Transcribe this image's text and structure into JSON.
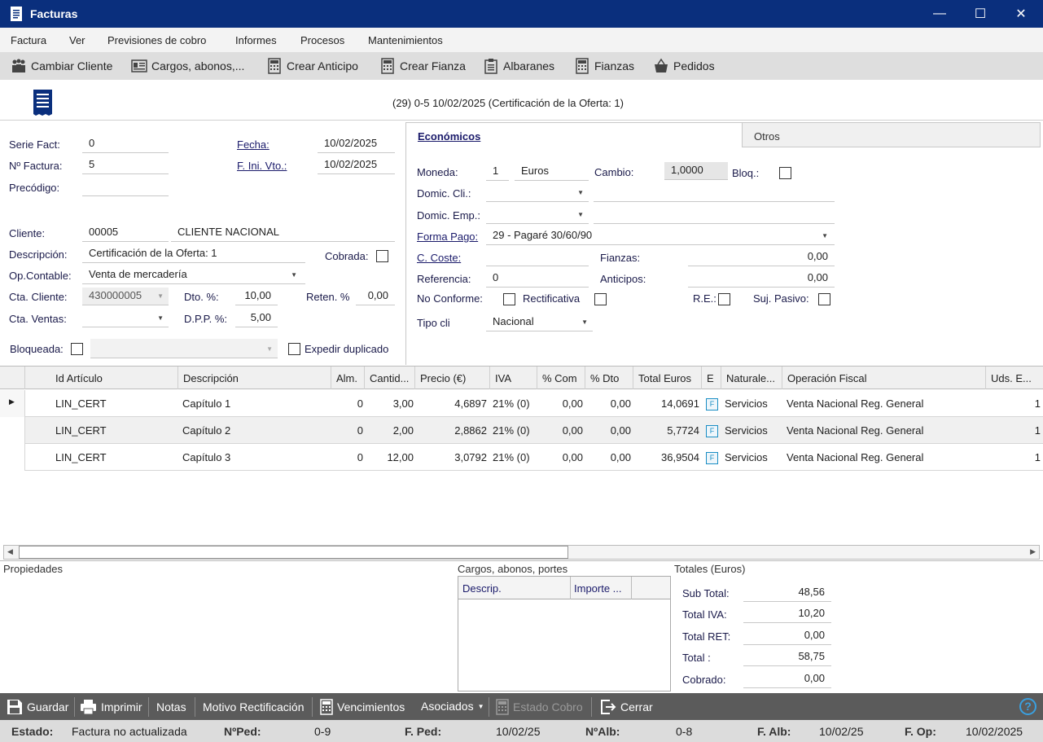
{
  "window": {
    "title": "Facturas",
    "minimize": "—",
    "maximize": "☐",
    "close": "✕"
  },
  "menu": [
    "Factura",
    "Ver",
    "Previsiones de cobro",
    "Informes",
    "Procesos",
    "Mantenimientos"
  ],
  "toolbar": {
    "cambiar_cliente": "Cambiar Cliente",
    "cargos": "Cargos, abonos,...",
    "crear_anticipo": "Crear Anticipo",
    "crear_fianza": "Crear Fianza",
    "albaranes": "Albaranes",
    "fianzas": "Fianzas",
    "pedidos": "Pedidos"
  },
  "header": {
    "summary": "(29) 0-5  10/02/2025  (Certificación de la Oferta: 1)"
  },
  "form": {
    "serie_fact_label": "Serie Fact:",
    "serie_fact": "0",
    "n_factura_label": "Nº Factura:",
    "n_factura": "5",
    "precodigo_label": "Precódigo:",
    "precodigo": "",
    "fecha_label": "Fecha:",
    "fecha": "10/02/2025",
    "f_ini_vto_label": "F. Ini. Vto.:",
    "f_ini_vto": "10/02/2025",
    "cliente_label": "Cliente:",
    "cliente_code": "00005",
    "cliente_name": "CLIENTE NACIONAL",
    "descripcion_label": "Descripción:",
    "descripcion": "Certificación de la Oferta: 1",
    "cobrada_label": "Cobrada:",
    "op_contable_label": "Op.Contable:",
    "op_contable": "Venta de mercadería",
    "cta_cliente_label": "Cta. Cliente:",
    "cta_cliente": "430000005",
    "dto_label": "Dto. %:",
    "dto": "10,00",
    "reten_label": "Reten. %",
    "reten": "0,00",
    "cta_ventas_label": "Cta. Ventas:",
    "cta_ventas": "",
    "dpp_label": "D.P.P. %:",
    "dpp": "5,00",
    "bloqueada_label": "Bloqueada:",
    "expedir_label": "Expedir duplicado"
  },
  "tabs": {
    "economicos": "Económicos",
    "otros": "Otros"
  },
  "econ": {
    "moneda_label": "Moneda:",
    "moneda_code": "1",
    "moneda_name": "Euros",
    "cambio_label": "Cambio:",
    "cambio": "1,0000",
    "bloq_label": "Bloq.:",
    "domic_cli_label": "Domic. Cli.:",
    "domic_emp_label": "Domic. Emp.:",
    "forma_pago_label": "Forma Pago:",
    "forma_pago": "29 - Pagaré 30/60/90",
    "c_coste_label": "C. Coste:",
    "fianzas_label": "Fianzas:",
    "fianzas": "0,00",
    "referencia_label": "Referencia:",
    "referencia": "0",
    "anticipos_label": "Anticipos:",
    "anticipos": "0,00",
    "no_conforme_label": "No Conforme:",
    "rectificativa_label": "Rectificativa",
    "re_label": "R.E.:",
    "suj_pasivo_label": "Suj. Pasivo:",
    "tipo_cli_label": "Tipo cli",
    "tipo_cli": "Nacional"
  },
  "grid": {
    "headers": [
      "Id Artículo",
      "Descripción",
      "Alm.",
      "Cantid...",
      "Precio (€)",
      "IVA",
      "% Com",
      "% Dto",
      "Total Euros",
      "E",
      "Naturale...",
      "Operación Fiscal",
      "Uds. E..."
    ],
    "rows": [
      {
        "id": "LIN_CERT",
        "desc": "Capítulo 1",
        "alm": "0",
        "cant": "3,00",
        "precio": "4,6897",
        "iva": "21% (0)",
        "com": "0,00",
        "dto": "0,00",
        "total": "14,0691",
        "e": "F",
        "nat": "Servicios",
        "op": "Venta Nacional Reg. General",
        "uds": "1"
      },
      {
        "id": "LIN_CERT",
        "desc": "Capítulo 2",
        "alm": "0",
        "cant": "2,00",
        "precio": "2,8862",
        "iva": "21% (0)",
        "com": "0,00",
        "dto": "0,00",
        "total": "5,7724",
        "e": "F",
        "nat": "Servicios",
        "op": "Venta Nacional Reg. General",
        "uds": "1"
      },
      {
        "id": "LIN_CERT",
        "desc": "Capítulo 3",
        "alm": "0",
        "cant": "12,00",
        "precio": "3,0792",
        "iva": "21% (0)",
        "com": "0,00",
        "dto": "0,00",
        "total": "36,9504",
        "e": "F",
        "nat": "Servicios",
        "op": "Venta Nacional Reg. General",
        "uds": "1"
      }
    ]
  },
  "bottom": {
    "propiedades": "Propiedades",
    "cargos_title": "Cargos, abonos, portes",
    "cargos_col1": "Descrip.",
    "cargos_col2": "Importe ...",
    "totales_title": "Totales (Euros)",
    "sub_total_label": "Sub Total:",
    "sub_total": "48,56",
    "total_iva_label": "Total IVA:",
    "total_iva": "10,20",
    "total_ret_label": "Total RET:",
    "total_ret": "0,00",
    "total_label": "Total :",
    "total": "58,75",
    "cobrado_label": "Cobrado:",
    "cobrado": "0,00"
  },
  "actions": {
    "guardar": "Guardar",
    "imprimir": "Imprimir",
    "notas": "Notas",
    "motivo": "Motivo Rectificación",
    "vencimientos": "Vencimientos",
    "asociados": "Asociados",
    "estado_cobro": "Estado Cobro",
    "cerrar": "Cerrar",
    "help": "?"
  },
  "status": {
    "estado_label": "Estado:",
    "estado": "Factura no actualizada",
    "nped_label": "NºPed:",
    "nped": "0-9",
    "fped_label": "F. Ped:",
    "fped": "10/02/25",
    "nalb_label": "NºAlb:",
    "nalb": "0-8",
    "falb_label": "F. Alb:",
    "falb": "10/02/25",
    "fop_label": "F. Op:",
    "fop": "10/02/2025"
  }
}
